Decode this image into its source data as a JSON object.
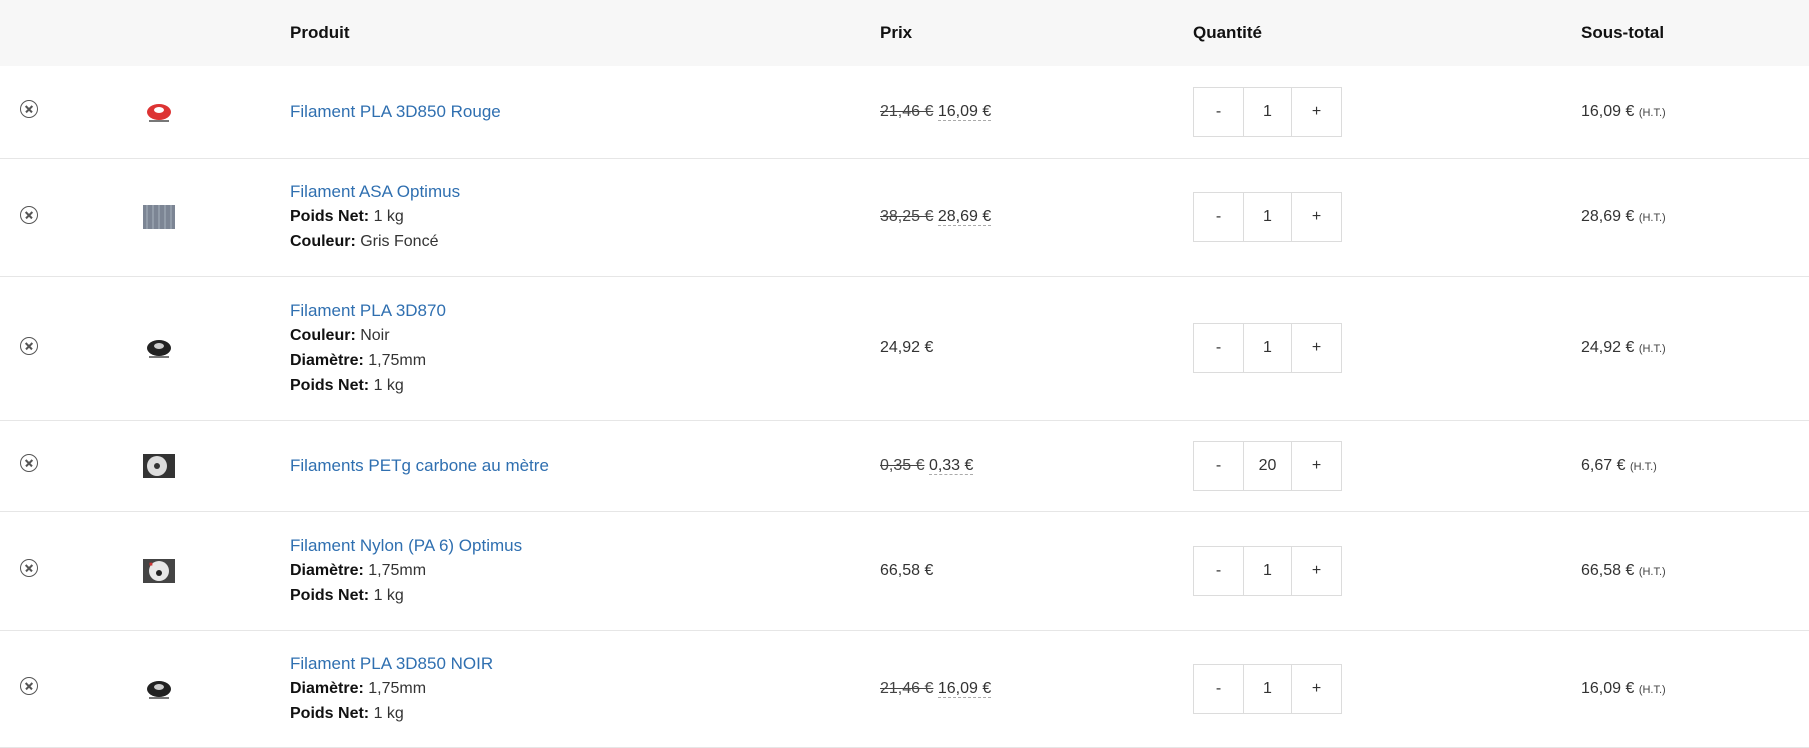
{
  "headers": {
    "product": "Produit",
    "price": "Prix",
    "quantity": "Quantité",
    "subtotal": "Sous-total"
  },
  "tax_label": "(H.T.)",
  "rows": [
    {
      "name": "Filament PLA 3D850 Rouge",
      "old_price": "21,46 €",
      "price": "16,09 €",
      "qty": "1",
      "subtotal": "16,09 €",
      "thumb": "red-spool"
    },
    {
      "name": "Filament ASA Optimus",
      "old_price": "38,25 €",
      "price": "28,69 €",
      "qty": "1",
      "subtotal": "28,69 €",
      "thumb": "grey-filament",
      "attrs": [
        {
          "k": "Poids Net:",
          "v": "1 kg"
        },
        {
          "k": "Couleur:",
          "v": "Gris Foncé"
        }
      ]
    },
    {
      "name": "Filament PLA 3D870",
      "price": "24,92 €",
      "qty": "1",
      "subtotal": "24,92 €",
      "thumb": "black-spool",
      "attrs": [
        {
          "k": "Couleur:",
          "v": "Noir"
        },
        {
          "k": "Diamètre:",
          "v": "1,75mm"
        },
        {
          "k": "Poids Net:",
          "v": "1 kg"
        }
      ]
    },
    {
      "name": "Filaments PETg carbone au mètre",
      "old_price": "0,35 €",
      "price": "0,33 €",
      "qty": "20",
      "subtotal": "6,67 €",
      "thumb": "carbon-spool"
    },
    {
      "name": "Filament Nylon (PA 6) Optimus",
      "price": "66,58 €",
      "qty": "1",
      "subtotal": "66,58 €",
      "thumb": "nylon-spool",
      "attrs": [
        {
          "k": "Diamètre:",
          "v": "1,75mm"
        },
        {
          "k": "Poids Net:",
          "v": "1 kg"
        }
      ]
    },
    {
      "name": "Filament PLA 3D850 NOIR",
      "old_price": "21,46 €",
      "price": "16,09 €",
      "qty": "1",
      "subtotal": "16,09 €",
      "thumb": "black-spool",
      "attrs": [
        {
          "k": "Diamètre:",
          "v": "1,75mm"
        },
        {
          "k": "Poids Net:",
          "v": "1 kg"
        }
      ]
    }
  ],
  "qty_minus": "-",
  "qty_plus": "+"
}
